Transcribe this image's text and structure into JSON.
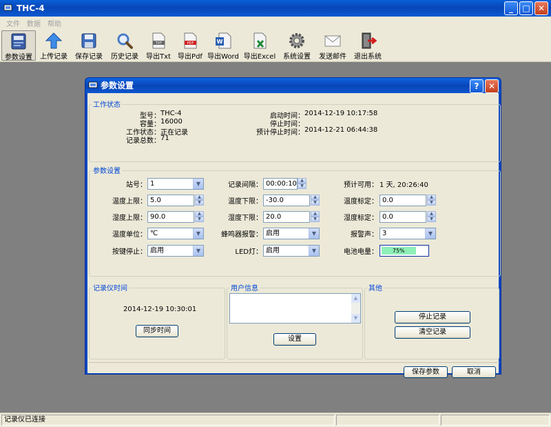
{
  "window": {
    "title": "THC-4"
  },
  "menu": [
    "文件",
    "数据",
    "帮助"
  ],
  "toolbar": [
    {
      "label": "参数设置",
      "icon": "settings-panel-icon",
      "active": true
    },
    {
      "label": "上传记录",
      "icon": "upload-arrow-icon"
    },
    {
      "label": "保存记录",
      "icon": "floppy-disk-icon"
    },
    {
      "label": "历史记录",
      "icon": "magnifier-icon"
    },
    {
      "label": "导出Txt",
      "icon": "txt-file-icon"
    },
    {
      "label": "导出Pdf",
      "icon": "pdf-file-icon"
    },
    {
      "label": "导出Word",
      "icon": "word-file-icon"
    },
    {
      "label": "导出Excel",
      "icon": "excel-file-icon"
    },
    {
      "label": "系统设置",
      "icon": "gear-icon"
    },
    {
      "label": "发送邮件",
      "icon": "envelope-icon"
    },
    {
      "label": "退出系统",
      "icon": "exit-door-icon"
    }
  ],
  "dialog": {
    "title": "参数设置",
    "help_glyph": "?",
    "close_glyph": "✕",
    "status": {
      "legend": "工作状态",
      "model_label": "型号：",
      "model": "THC-4",
      "capacity_label": "容量：",
      "capacity": "16000",
      "state_label": "工作状态：",
      "state": "正在记录",
      "total_label": "记录总数：",
      "total": "71",
      "start_label": "启动时间：",
      "start": "2014-12-19 10:17:58",
      "stop_label": "停止时间：",
      "stop": "",
      "expected_stop_label": "预计停止时间：",
      "expected_stop": "2014-12-21 06:44:38"
    },
    "params": {
      "legend": "参数设置",
      "station_label": "站号：",
      "station": "1",
      "interval_label": "记录间隔：",
      "interval": "00:00:10",
      "available_label": "预计可用：",
      "available": "1 天, 20:26:40",
      "temp_high_label": "温度上限：",
      "temp_high": "5.0",
      "temp_low_label": "温度下限：",
      "temp_low": "-30.0",
      "temp_cal_label": "温度标定：",
      "temp_cal": "0.0",
      "hum_high_label": "湿度上限：",
      "hum_high": "90.0",
      "hum_low_label": "湿度下限：",
      "hum_low": "20.0",
      "hum_cal_label": "湿度标定：",
      "hum_cal": "0.0",
      "temp_unit_label": "温度单位：",
      "temp_unit": "℃",
      "buzzer_label": "蜂鸣器报警：",
      "buzzer": "启用",
      "alarm_label": "报警声：",
      "alarm": "3",
      "key_stop_label": "按键停止：",
      "key_stop": "启用",
      "led_label": "LED灯：",
      "led": "启用",
      "battery_label": "电池电量：",
      "battery_text": "75%",
      "battery_level": 0.75
    },
    "clock": {
      "legend": "记录仪时间",
      "time": "2014-12-19 10:30:01",
      "sync_button": "同步时间"
    },
    "user": {
      "legend": "用户信息",
      "set_button": "设置"
    },
    "other": {
      "legend": "其他",
      "stop_button": "停止记录",
      "clear_button": "清空记录"
    },
    "save_button": "保存参数",
    "cancel_button": "取消"
  },
  "statusbar": {
    "text": "记录仪已连接"
  }
}
